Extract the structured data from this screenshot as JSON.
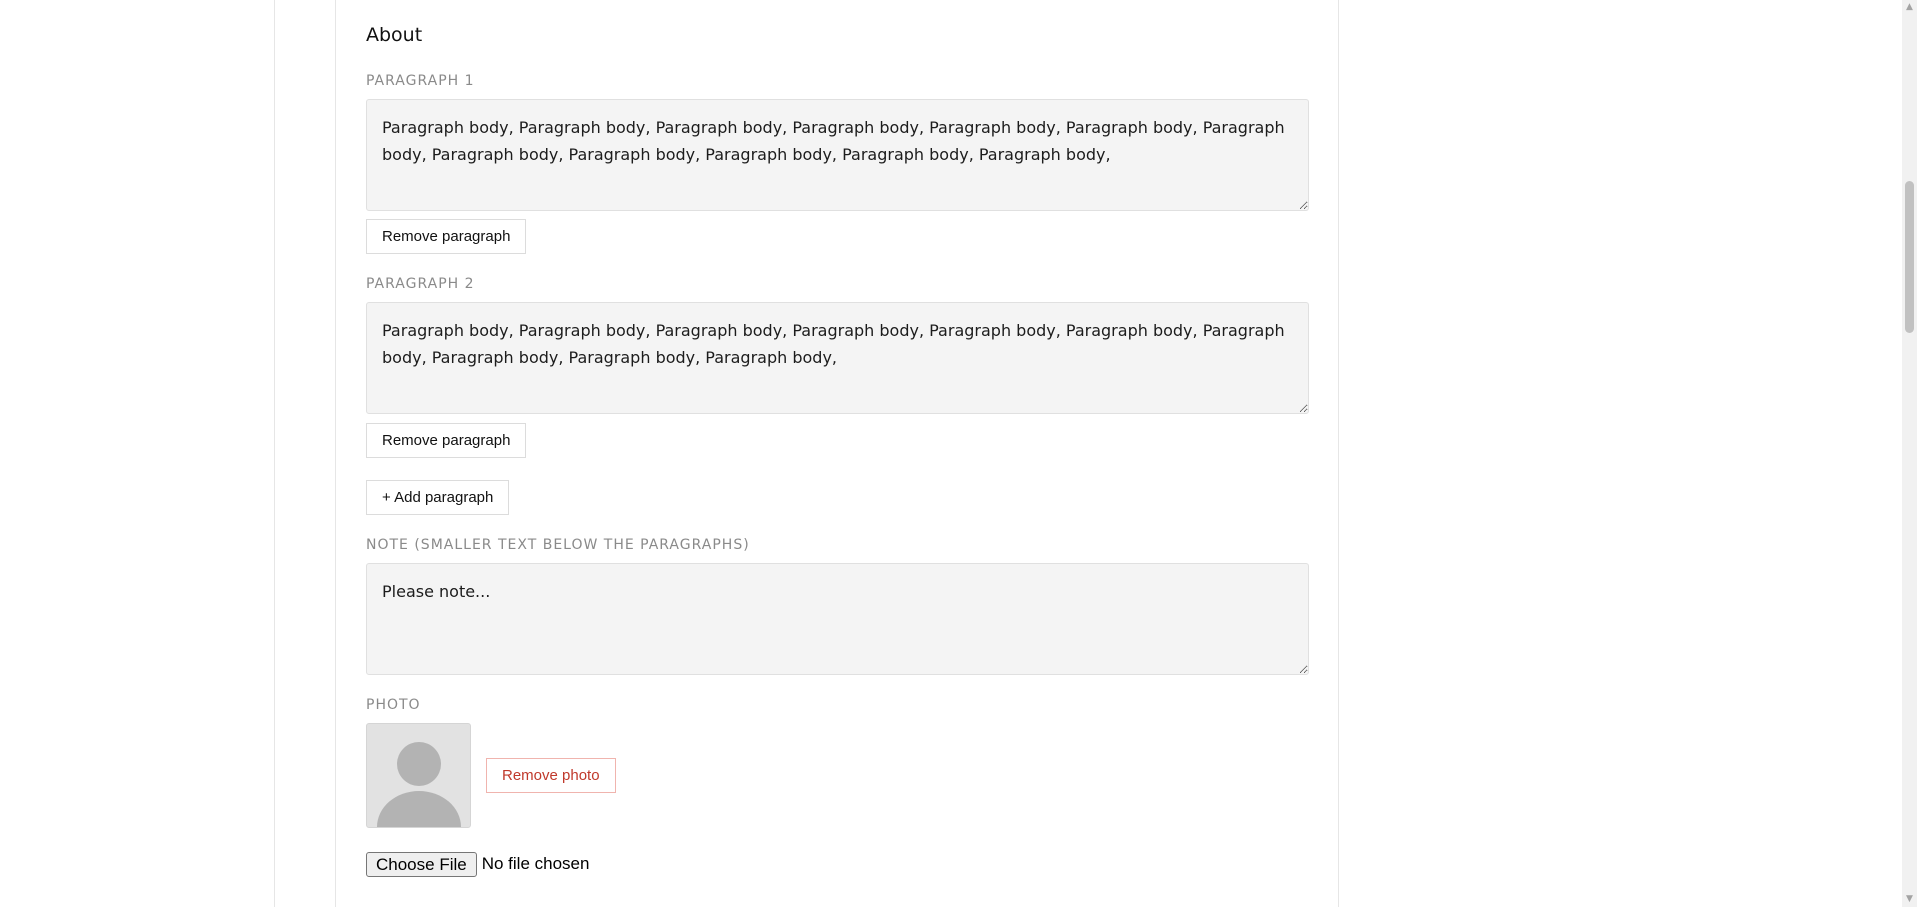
{
  "section": {
    "title": "About"
  },
  "paragraphs": [
    {
      "label": "Paragraph 1",
      "value": "Paragraph body, Paragraph body, Paragraph body, Paragraph body, Paragraph body, Paragraph body, Paragraph body, Paragraph body, Paragraph body, Paragraph body, Paragraph body, Paragraph body,",
      "remove_label": "Remove paragraph"
    },
    {
      "label": "Paragraph 2",
      "value": "Paragraph body, Paragraph body, Paragraph body, Paragraph body, Paragraph body, Paragraph body, Paragraph body, Paragraph body, Paragraph body, Paragraph body,",
      "remove_label": "Remove paragraph"
    }
  ],
  "add_paragraph_label": "+ Add paragraph",
  "note": {
    "label": "Note (smaller text below the paragraphs)",
    "value": "Please note..."
  },
  "photo": {
    "label": "Photo",
    "remove_label": "Remove photo",
    "avatar_icon": "person-silhouette-icon"
  },
  "file_input": {
    "button_label": "Choose File",
    "status": "No file chosen"
  },
  "colors": {
    "danger": "#c0392b",
    "field_background": "#f4f4f4",
    "label": "#8a8a8a"
  }
}
